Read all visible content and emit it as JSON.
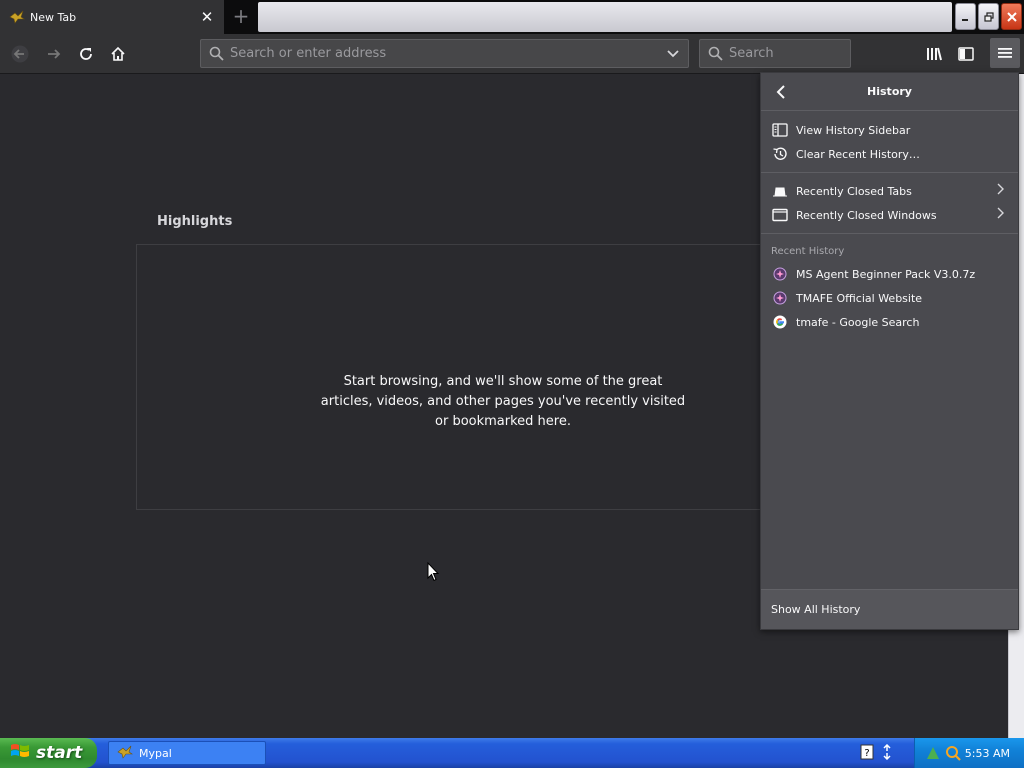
{
  "browser": {
    "tab": {
      "title": "New Tab"
    },
    "window_controls": {
      "minimize": "_",
      "restore": "❐",
      "close": "✕"
    },
    "toolbar": {
      "address_placeholder": "Search or enter address",
      "search_placeholder": "Search"
    }
  },
  "new_tab": {
    "highlights_title": "Highlights",
    "highlights_message": "Start browsing, and we'll show some of the great articles, videos, and other pages you've recently visited or bookmarked here."
  },
  "history_panel": {
    "title": "History",
    "items": [
      {
        "label": "View History Sidebar",
        "icon": "sidebar-icon"
      },
      {
        "label": "Clear Recent History…",
        "icon": "history-clock-icon"
      }
    ],
    "closed": [
      {
        "label": "Recently Closed Tabs",
        "icon": "tab-icon"
      },
      {
        "label": "Recently Closed Windows",
        "icon": "window-icon"
      }
    ],
    "recent_label": "Recent History",
    "recent": [
      {
        "label": "MS Agent Beginner Pack V3.0.7z",
        "icon": "site-favicon"
      },
      {
        "label": "TMAFE Official Website",
        "icon": "site-favicon"
      },
      {
        "label": "tmafe - Google Search",
        "icon": "google-icon"
      }
    ],
    "footer": "Show All History"
  },
  "taskbar": {
    "start_label": "start",
    "task_item": "Mypal",
    "clock": "5:53 AM"
  }
}
